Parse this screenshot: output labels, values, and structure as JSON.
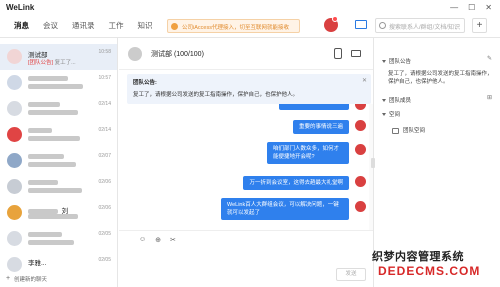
{
  "window": {
    "title": "WeLink",
    "controls": [
      "—",
      "☐",
      "✕"
    ]
  },
  "nav": {
    "tabs": [
      "消息",
      "会议",
      "通讯录",
      "工作",
      "知识"
    ],
    "notice": "公司iAccess代理接入，切至互联网就能接收",
    "search_placeholder": "搜索联系人/群组/文档/知识",
    "add_label": "+"
  },
  "conversations": {
    "items": [
      {
        "name": "测试部",
        "sub_tag": "[团队公告]",
        "sub": "复工了...",
        "time": "10:58",
        "avatar_color": "#f1d5d5"
      },
      {
        "name": "",
        "sub": "",
        "time": "10:57",
        "avatar_color": "#cfd8e6"
      },
      {
        "name": "",
        "sub": "",
        "time": "02/14",
        "avatar_color": "#d7dbe2"
      },
      {
        "name": "",
        "sub": "",
        "time": "02/14",
        "avatar_color": "#e04444"
      },
      {
        "name": "",
        "sub": "",
        "time": "02/07",
        "avatar_color": "#8fa8c8"
      },
      {
        "name": "",
        "sub": "",
        "time": "02/06",
        "avatar_color": "#c7ccd4"
      },
      {
        "name": "_刘",
        "sub": "",
        "time": "02/06",
        "avatar_color": "#e8a33c"
      },
      {
        "name": "",
        "sub": "",
        "time": "02/05",
        "avatar_color": "#d7dbe2"
      },
      {
        "name": "李雅...",
        "sub": "",
        "time": "02/05",
        "avatar_color": "#d7dbe2"
      }
    ],
    "footer": "创建新的聊天"
  },
  "chat": {
    "title": "测试部 (100/100)",
    "announcement_title": "团队公告:",
    "announcement_text": "复工了，请根据公司发送的复工指南操作，保护自己，也保护他人。",
    "messages": [
      "",
      "重要的事情说三遍",
      "咱们部门人数众多，如何才能便捷地开会呢?",
      "万一折到会议室，这得去趟最大礼堂啊",
      "WeLink百人大群组会议，可以解决问题，一键就可以发起了"
    ],
    "send_label": "发送"
  },
  "side": {
    "announcement_label": "团队公告",
    "announcement_text": "复工了，请根据公司发送的复工指南操作，保护自己，也保护他人。",
    "members_label": "团队成员",
    "space_label": "空间",
    "space_item": "团队空间"
  },
  "watermark": {
    "line1": "织梦内容管理系统",
    "line2": "DEDECMS.COM"
  },
  "colors": {
    "accent": "#2f80ed",
    "avatar_red": "#d94040",
    "selected_row": "#e8eef7"
  }
}
